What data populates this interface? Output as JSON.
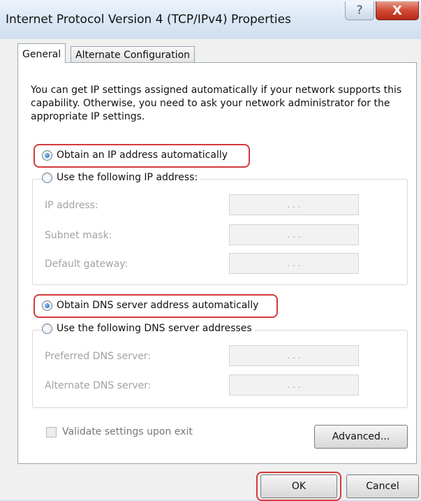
{
  "window": {
    "title": "Internet Protocol Version 4 (TCP/IPv4) Properties",
    "help_glyph": "?",
    "close_glyph": "X"
  },
  "tabs": [
    {
      "label": "General"
    },
    {
      "label": "Alternate Configuration"
    }
  ],
  "description": "You can get IP settings assigned automatically if your network supports this capability. Otherwise, you need to ask your network administrator for the appropriate IP settings.",
  "ip": {
    "auto_label": "Obtain an IP address automatically",
    "manual_label": "Use the following IP address:",
    "fields": [
      {
        "label": "IP address:",
        "value": ".   .   ."
      },
      {
        "label": "Subnet mask:",
        "value": ".   .   ."
      },
      {
        "label": "Default gateway:",
        "value": ".   .   ."
      }
    ]
  },
  "dns": {
    "auto_label": "Obtain DNS server address automatically",
    "manual_label": "Use the following DNS server addresses",
    "fields": [
      {
        "label": "Preferred DNS server:",
        "value": ".   .   ."
      },
      {
        "label": "Alternate DNS server:",
        "value": ".   .   ."
      }
    ]
  },
  "validate_label": "Validate settings upon exit",
  "buttons": {
    "advanced": "Advanced...",
    "ok": "OK",
    "cancel": "Cancel"
  },
  "colors": {
    "highlight": "#d33b3b",
    "close_button": "#c83a26"
  }
}
